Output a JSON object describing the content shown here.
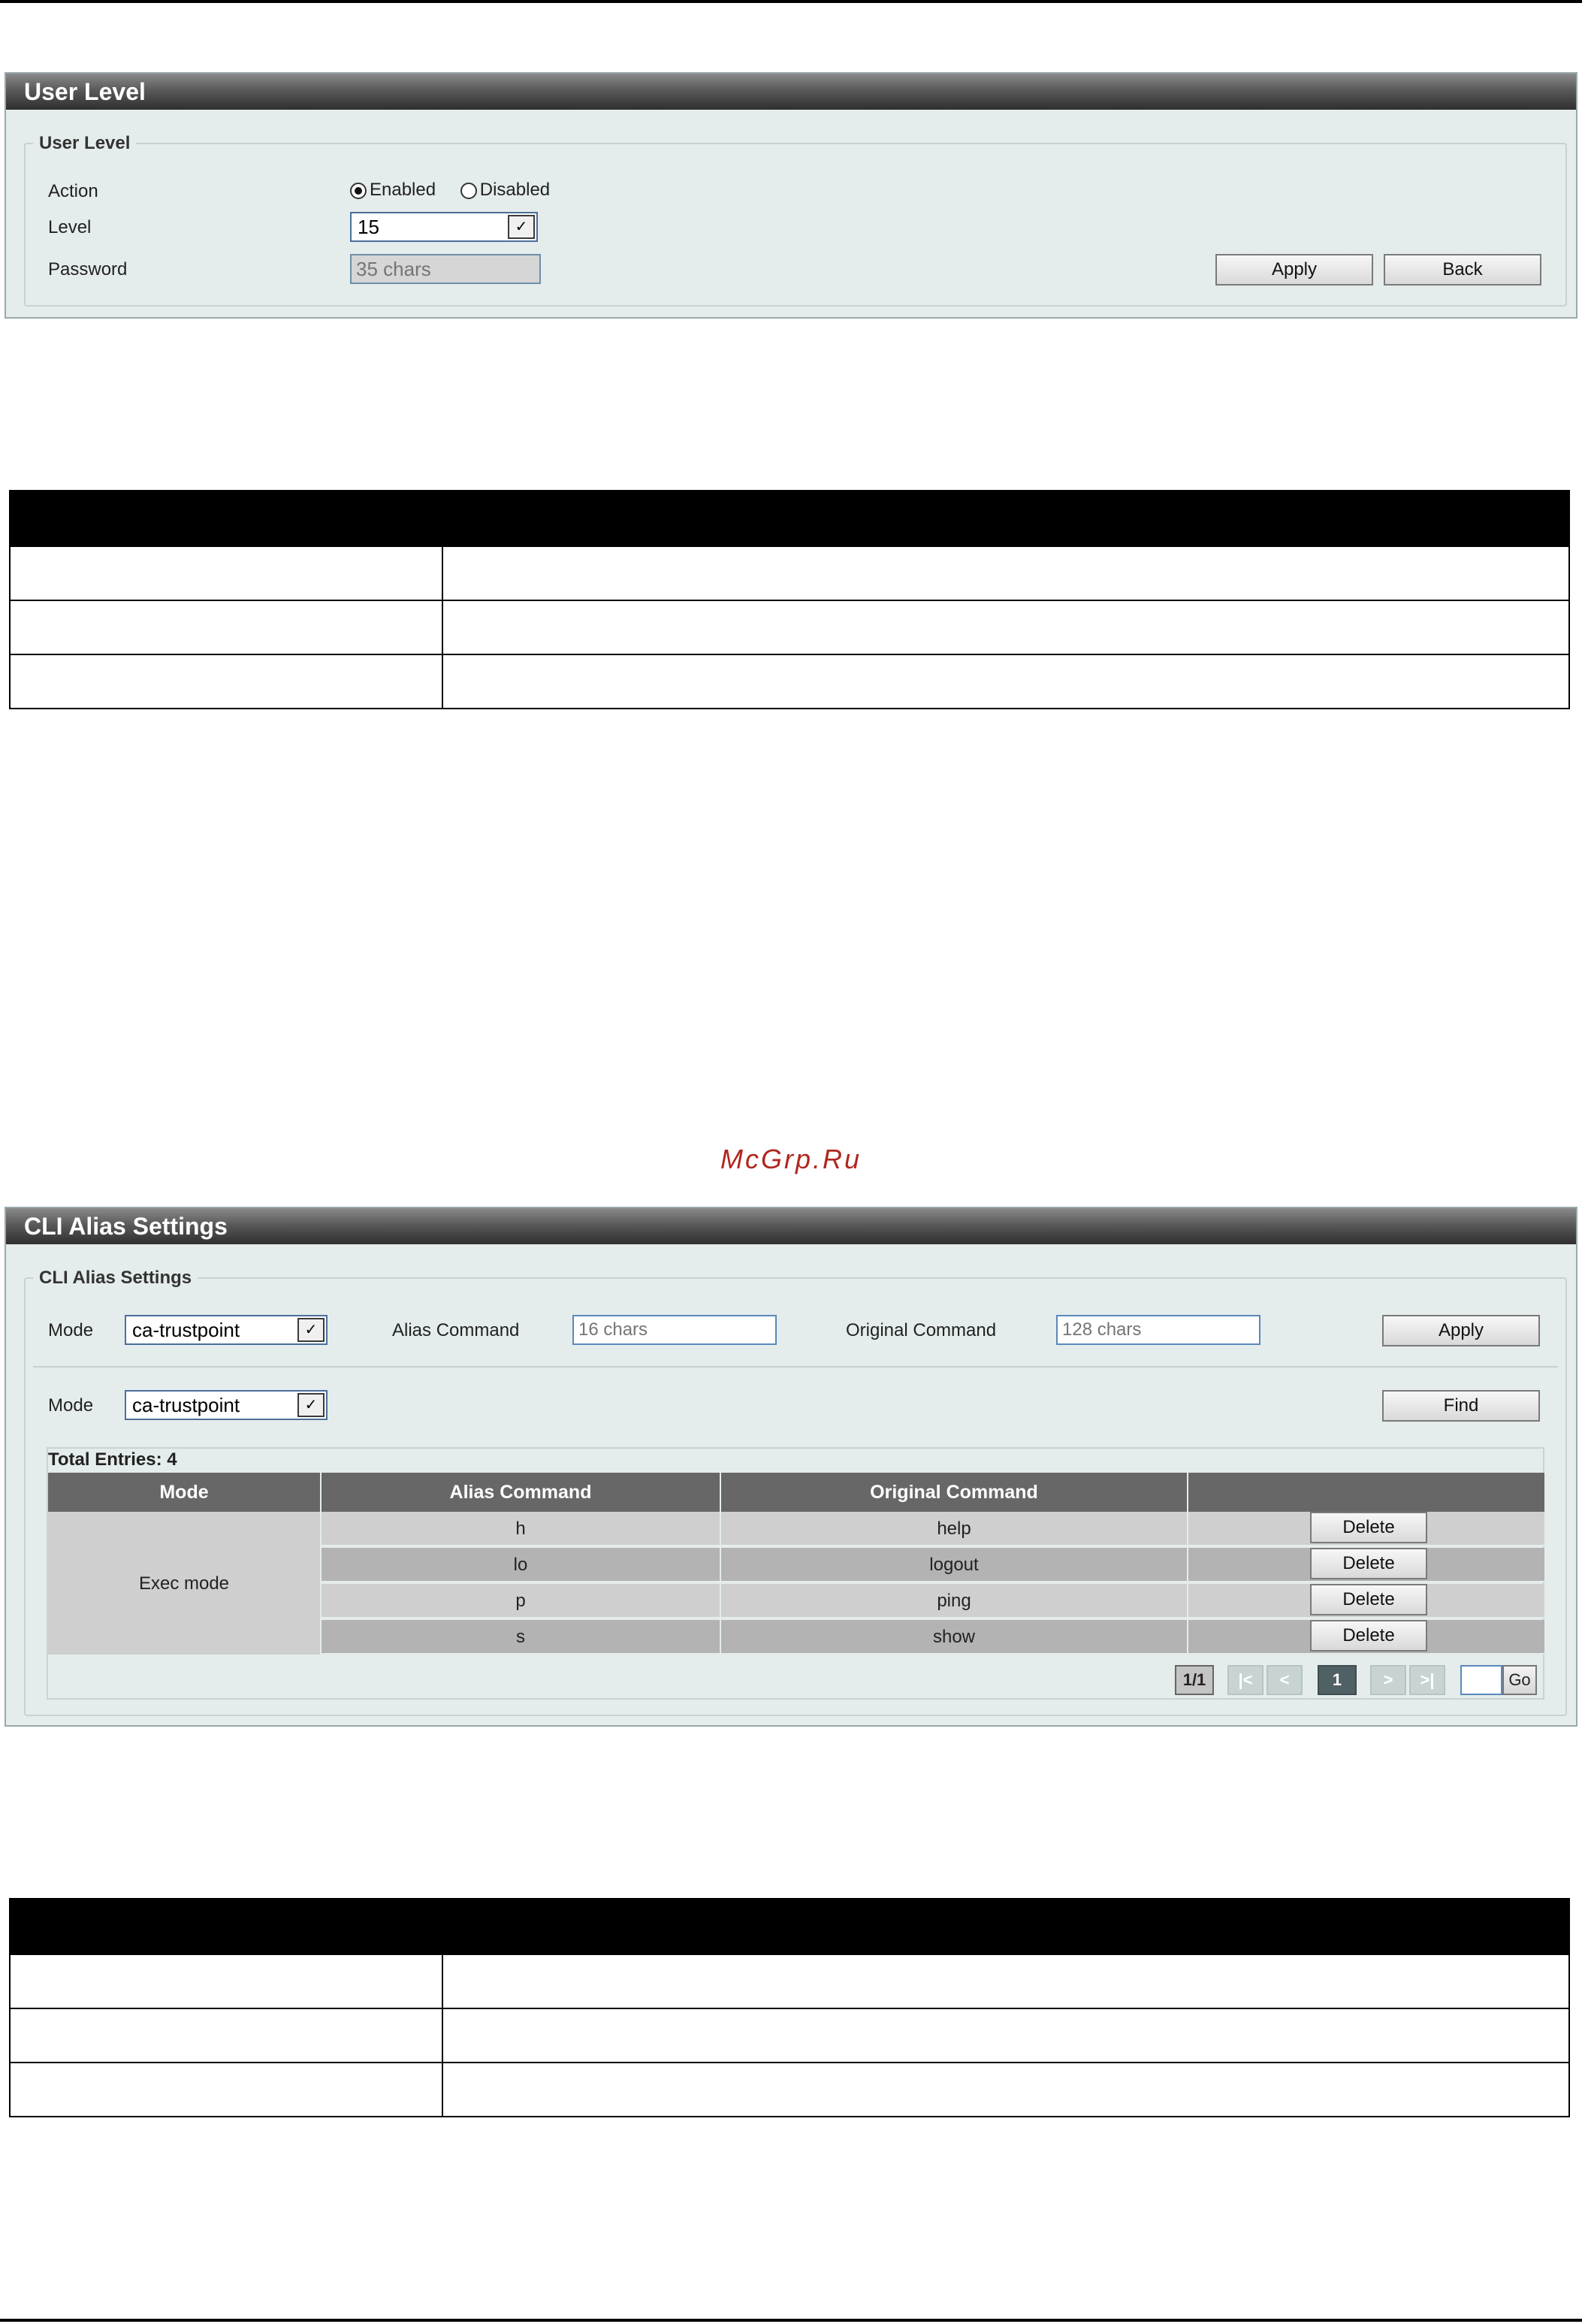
{
  "user_level": {
    "title": "User Level",
    "legend": "User Level",
    "action_label": "Action",
    "action_enabled": "Enabled",
    "action_disabled": "Disabled",
    "level_label": "Level",
    "level_value": "15",
    "password_label": "Password",
    "password_placeholder": "35 chars",
    "apply": "Apply",
    "back": "Back"
  },
  "watermark": "McGrp.Ru",
  "cli_alias": {
    "title": "CLI Alias Settings",
    "legend": "CLI Alias Settings",
    "mode_label": "Mode",
    "mode_value": "ca-trustpoint",
    "alias_label": "Alias Command",
    "alias_placeholder": "16 chars",
    "original_label": "Original Command",
    "original_placeholder": "128 chars",
    "apply": "Apply",
    "find_mode_label": "Mode",
    "find_mode_value": "ca-trustpoint",
    "find": "Find",
    "total_entries": "Total Entries: 4",
    "columns": [
      "Mode",
      "Alias Command",
      "Original Command",
      ""
    ],
    "group_mode": "Exec mode",
    "rows": [
      {
        "alias": "h",
        "original": "help",
        "action": "Delete"
      },
      {
        "alias": "lo",
        "original": "logout",
        "action": "Delete"
      },
      {
        "alias": "p",
        "original": "ping",
        "action": "Delete"
      },
      {
        "alias": "s",
        "original": "show",
        "action": "Delete"
      }
    ],
    "pagination": {
      "page_info": "1/1",
      "first": "|<",
      "prev": "<",
      "current": "1",
      "next": ">",
      "last": ">|",
      "go": "Go"
    }
  }
}
